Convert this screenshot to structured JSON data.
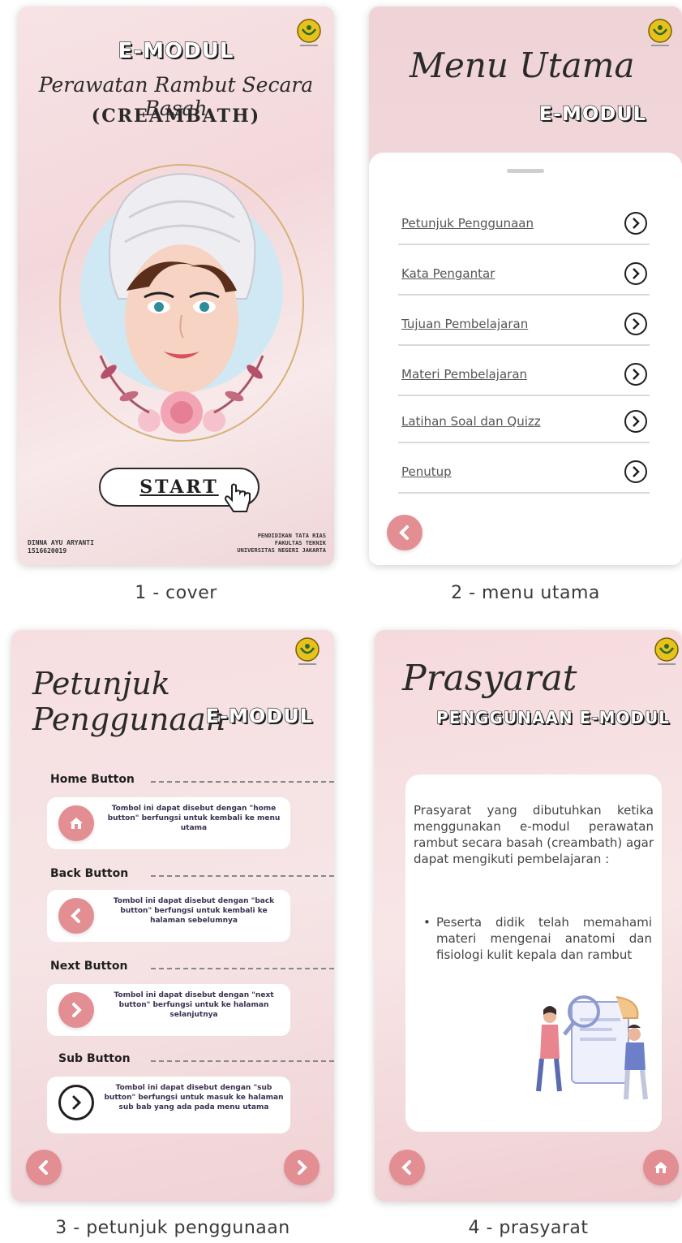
{
  "captions": [
    "1 - cover",
    "2 - menu utama",
    "3 - petunjuk penggunaan",
    "4 - prasyarat"
  ],
  "cover": {
    "emodul": "E-MODUL",
    "title_line1": "Perawatan Rambut Secara Basah",
    "title_line2": "(CREAMBATH)",
    "start_label": "START",
    "author_name": "DINNA AYU ARYANTI",
    "author_id": "1516620019",
    "institution_line1": "PENDIDIKAN TATA RIAS",
    "institution_line2": "FAKULTAS TEKNIK",
    "institution_line3": "UNIVERSITAS NEGERI JAKARTA"
  },
  "menu": {
    "title_script": "Menu Utama",
    "title_block": "E-MODUL",
    "items": [
      {
        "label": "Petunjuk Penggunaan"
      },
      {
        "label": "Kata Pengantar"
      },
      {
        "label": "Tujuan Pembelajaran"
      },
      {
        "label": "Materi Pembelajaran"
      },
      {
        "label": "Latihan Soal dan Quizz"
      },
      {
        "label": "Penutup"
      }
    ]
  },
  "petunjuk": {
    "title_script": "Petunjuk Penggunaan",
    "title_block": "E-MODUL",
    "sections": [
      {
        "label": "Home Button",
        "desc": "Tombol ini dapat disebut dengan \"home button\" berfungsi untuk kembali ke menu utama"
      },
      {
        "label": "Back Button",
        "desc": "Tombol ini dapat disebut dengan \"back button\" berfungsi untuk kembali ke halaman sebelumnya"
      },
      {
        "label": "Next Button",
        "desc": "Tombol ini dapat disebut dengan \"next button\" berfungsi untuk ke halaman selanjutnya"
      },
      {
        "label": "Sub Button",
        "desc": "Tombol ini dapat disebut dengan \"sub button\" berfungsi untuk masuk ke halaman sub bab yang ada pada menu utama"
      }
    ]
  },
  "prasyarat": {
    "title_script": "Prasyarat",
    "title_block": "PENGGUNAAN E-MODUL",
    "intro": "Prasyarat yang dibutuhkan ketika menggunakan e-modul perawatan rambut secara basah (creambath) agar dapat mengikuti pembelajaran :",
    "bullet": "Peserta didik telah memahami materi mengenai anatomi dan fisiologi kulit kepala dan rambut"
  },
  "colors": {
    "accent_pink": "#e38e93",
    "panel_pink": "#f5dfe1",
    "text_dark": "#1f1f1f"
  }
}
